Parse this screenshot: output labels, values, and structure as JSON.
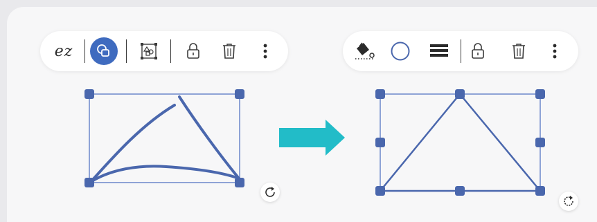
{
  "left_toolbar": {
    "logo_text": "ez",
    "buttons": [
      {
        "name": "shape-recognize-icon",
        "active": true
      },
      {
        "name": "convert-shape-icon",
        "active": false
      },
      {
        "name": "lock-icon",
        "active": false
      },
      {
        "name": "trash-icon",
        "active": false
      },
      {
        "name": "more-vertical-icon",
        "active": false
      }
    ]
  },
  "right_toolbar": {
    "buttons": [
      {
        "name": "fill-bucket-icon"
      },
      {
        "name": "circle-outline-icon"
      },
      {
        "name": "line-weight-icon"
      },
      {
        "name": "lock-icon"
      },
      {
        "name": "trash-icon"
      },
      {
        "name": "more-vertical-icon"
      }
    ]
  },
  "colors": {
    "accent": "#3f6bbf",
    "handle": "#4a67ad",
    "selection_frame": "#8ea3d6",
    "stroke": "#4a67ad",
    "arrow": "#22bcc8",
    "icon": "#3a3a3a"
  }
}
